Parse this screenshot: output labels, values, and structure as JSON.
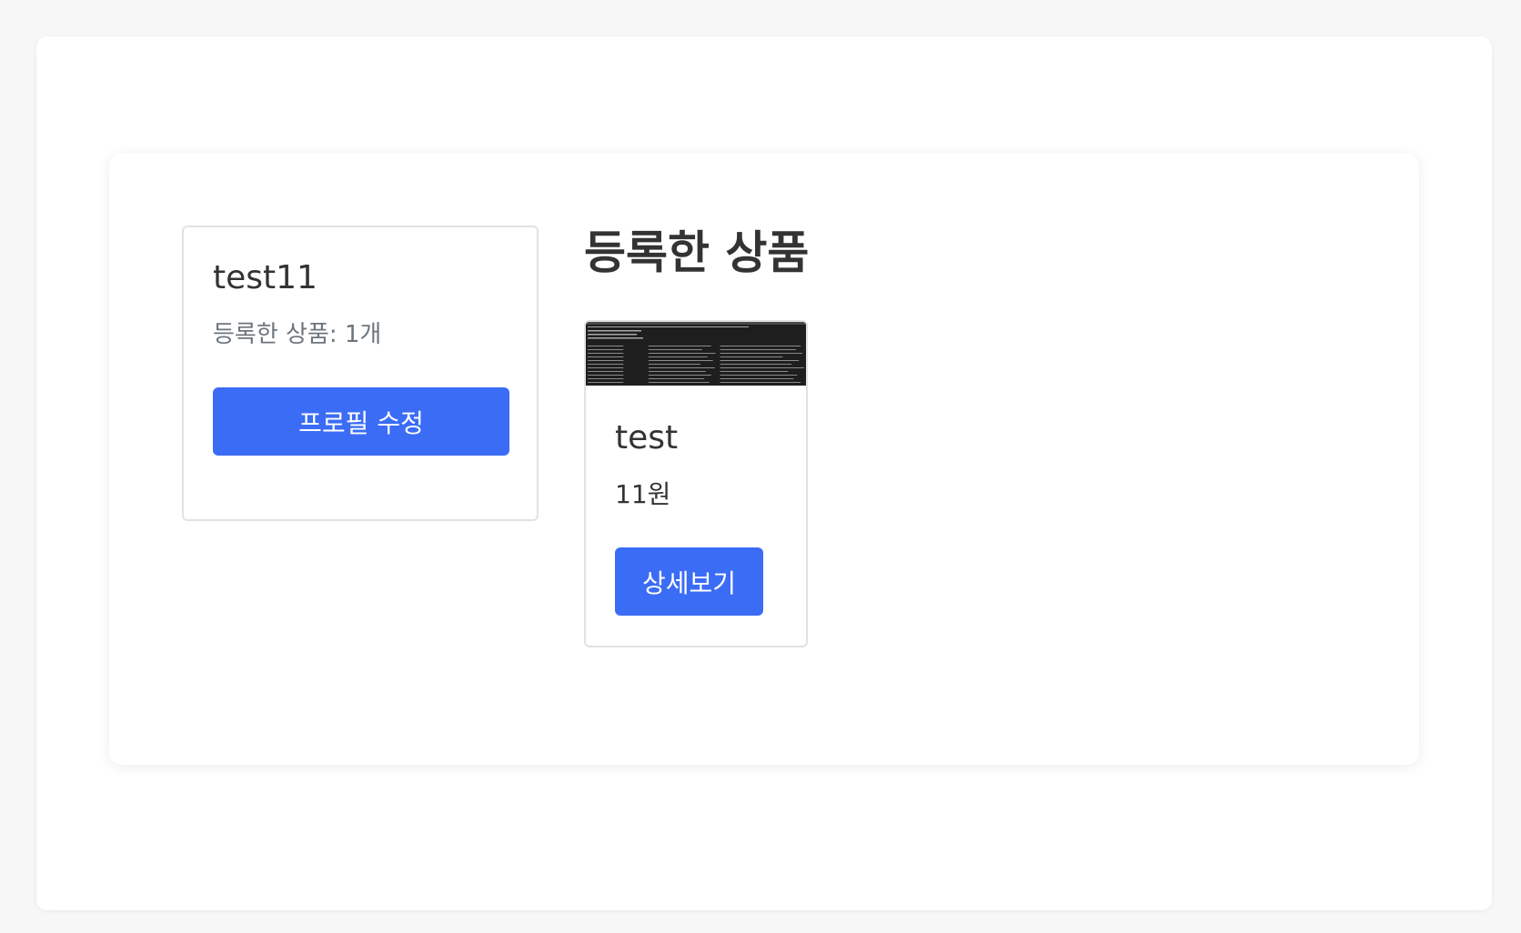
{
  "profile": {
    "username": "test11",
    "product_count_label": "등록한 상품: 1개",
    "edit_button_label": "프로필 수정"
  },
  "products_section": {
    "title": "등록한 상품",
    "items": [
      {
        "name": "test",
        "price": "11원",
        "detail_button_label": "상세보기"
      }
    ]
  },
  "colors": {
    "primary": "#3b6cf6",
    "text": "#333333",
    "muted_text": "#6c757d",
    "card_border": "#e2e2e2",
    "page_background": "#f7f7f7"
  }
}
